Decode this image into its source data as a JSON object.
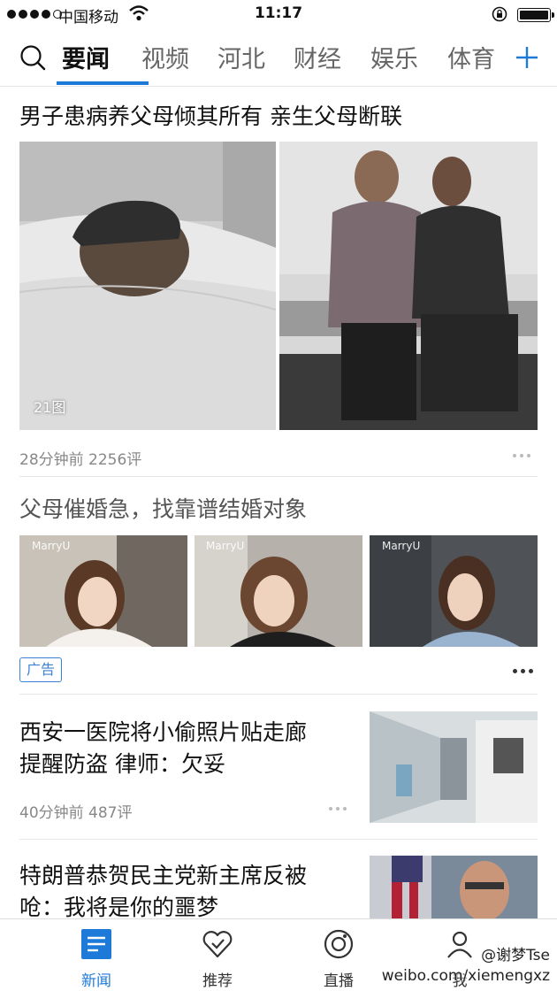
{
  "status_bar": {
    "carrier": "中国移动",
    "time": "11:17"
  },
  "tabs": {
    "items": [
      "要闻",
      "视频",
      "河北",
      "财经",
      "娱乐",
      "体育"
    ],
    "active": "要闻"
  },
  "feed": [
    {
      "title": "男子患病养父母倾其所有 亲生父母断联",
      "image_count": "21图",
      "time": "28分钟前",
      "comments": "2256评"
    },
    {
      "title": "父母催婚急，找靠谱结婚对象",
      "badge": "广告",
      "brand": "MarryU"
    },
    {
      "title_line1": "西安一医院将小偷照片贴走廊",
      "title_line2": "提醒防盗 律师：欠妥",
      "time": "40分钟前",
      "comments": "487评"
    },
    {
      "title_line1": "特朗普恭贺民主党新主席反被",
      "title_line2": "呛：我将是你的噩梦"
    }
  ],
  "bottom_nav": [
    {
      "label": "新闻",
      "icon": "news-icon"
    },
    {
      "label": "推荐",
      "icon": "heart-check-icon"
    },
    {
      "label": "直播",
      "icon": "live-icon"
    },
    {
      "label": "我",
      "icon": "profile-icon"
    }
  ],
  "watermark": {
    "handle": "@谢梦Tse",
    "url": "weibo.com/xiemengxz"
  },
  "colors": {
    "accent": "#1e7ad8",
    "ad_border": "#3b82d6",
    "meta_text": "#888888"
  }
}
